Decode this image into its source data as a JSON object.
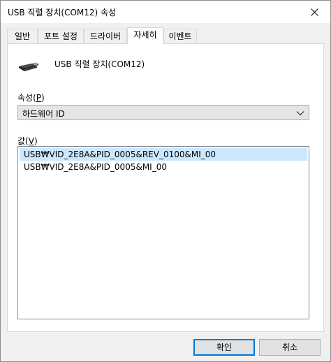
{
  "window": {
    "title": "USB 직렬 장치(COM12) 속성"
  },
  "tabs": [
    {
      "label": "일반"
    },
    {
      "label": "포트 설정"
    },
    {
      "label": "드라이버"
    },
    {
      "label": "자세히"
    },
    {
      "label": "이벤트"
    }
  ],
  "active_tab": "자세히",
  "device": {
    "icon": "usb-plug-icon",
    "name": "USB 직렬 장치(COM12)"
  },
  "property": {
    "label": "속성",
    "accesskey_open": "(",
    "accesskey": "P",
    "accesskey_close": ")",
    "selected": "하드웨어 ID"
  },
  "value": {
    "label": "값",
    "accesskey_open": "(",
    "accesskey": "V",
    "accesskey_close": ")",
    "items": [
      {
        "text": "USB₩VID_2E8A&PID_0005&REV_0100&MI_00",
        "selected": true
      },
      {
        "text": "USB₩VID_2E8A&PID_0005&MI_00",
        "selected": false
      }
    ]
  },
  "buttons": {
    "ok": "확인",
    "cancel": "취소"
  },
  "colors": {
    "selection": "#cce8ff",
    "default_button_border": "#0078d7"
  }
}
